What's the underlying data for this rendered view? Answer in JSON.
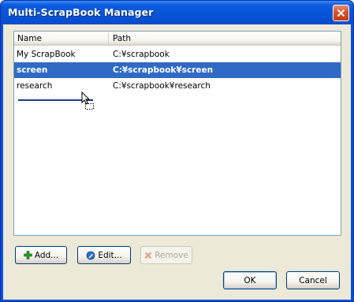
{
  "window": {
    "title": "Multi-ScrapBook Manager"
  },
  "list": {
    "columns": {
      "name": "Name",
      "path": "Path"
    },
    "rows": [
      {
        "name": "My ScrapBook",
        "path": "C:¥scrapbook"
      },
      {
        "name": "screen",
        "path": "C:¥scrapbook¥screen"
      },
      {
        "name": "research",
        "path": "C:¥scrapbook¥research"
      }
    ]
  },
  "buttons": {
    "add": "Add...",
    "edit": "Edit...",
    "remove": "Remove",
    "ok": "OK",
    "cancel": "Cancel"
  },
  "colors": {
    "titlebar": "#0654d6",
    "selection": "#316ac5",
    "dialog_bg": "#ece9d8",
    "add_icon": "#2e9a2e",
    "edit_icon": "#2d6fcf",
    "remove_icon": "#d24a3a"
  },
  "icons": {
    "close": "close-icon",
    "add": "plus-icon",
    "edit": "pencil-globe-icon",
    "remove": "x-icon",
    "cursor": "drag-cursor-icon"
  }
}
